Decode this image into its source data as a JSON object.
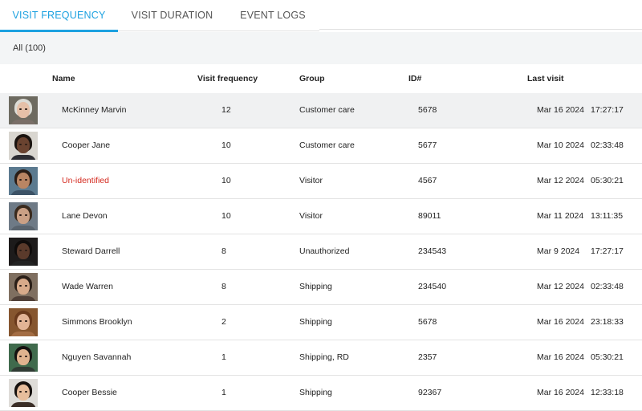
{
  "tabs": [
    {
      "label": "VISIT FREQUENCY",
      "active": true
    },
    {
      "label": "VISIT DURATION",
      "active": false
    },
    {
      "label": "EVENT LOGS",
      "active": false
    }
  ],
  "filter": {
    "label": "All (100)"
  },
  "columns": {
    "name": "Name",
    "visit_frequency": "Visit frequency",
    "group": "Group",
    "id": "ID#",
    "last_visit": "Last visit"
  },
  "accent_color": "#1ca1e0",
  "unidentified_color": "#d42a1f",
  "rows": [
    {
      "name": "McKinney Marvin",
      "frequency": "12",
      "group": "Customer care",
      "id": "5678",
      "date": "Mar 16 2024",
      "time": "17:27:17",
      "selected": true
    },
    {
      "name": "Cooper Jane",
      "frequency": "10",
      "group": "Customer care",
      "id": "5677",
      "date": "Mar 10 2024",
      "time": "02:33:48"
    },
    {
      "name": "Un-identified",
      "frequency": "10",
      "group": "Visitor",
      "id": "4567",
      "date": "Mar 12 2024",
      "time": "05:30:21",
      "unidentified": true
    },
    {
      "name": "Lane Devon",
      "frequency": "10",
      "group": "Visitor",
      "id": "89011",
      "date": "Mar 11 2024",
      "time": "13:11:35"
    },
    {
      "name": "Steward Darrell",
      "frequency": "8",
      "group": "Unauthorized",
      "id": "234543",
      "date": "Mar 9 2024",
      "time": "17:27:17"
    },
    {
      "name": "Wade Warren",
      "frequency": "8",
      "group": "Shipping",
      "id": "234540",
      "date": "Mar 12 2024",
      "time": "02:33:48"
    },
    {
      "name": "Simmons Brooklyn",
      "frequency": "2",
      "group": "Shipping",
      "id": "5678",
      "date": "Mar 16 2024",
      "time": "23:18:33"
    },
    {
      "name": "Nguyen Savannah",
      "frequency": "1",
      "group": "Shipping, RD",
      "id": "2357",
      "date": "Mar 16 2024",
      "time": "05:30:21"
    },
    {
      "name": "Cooper Bessie",
      "frequency": "1",
      "group": "Shipping",
      "id": "92367",
      "date": "Mar 16 2024",
      "time": "12:33:18"
    }
  ]
}
